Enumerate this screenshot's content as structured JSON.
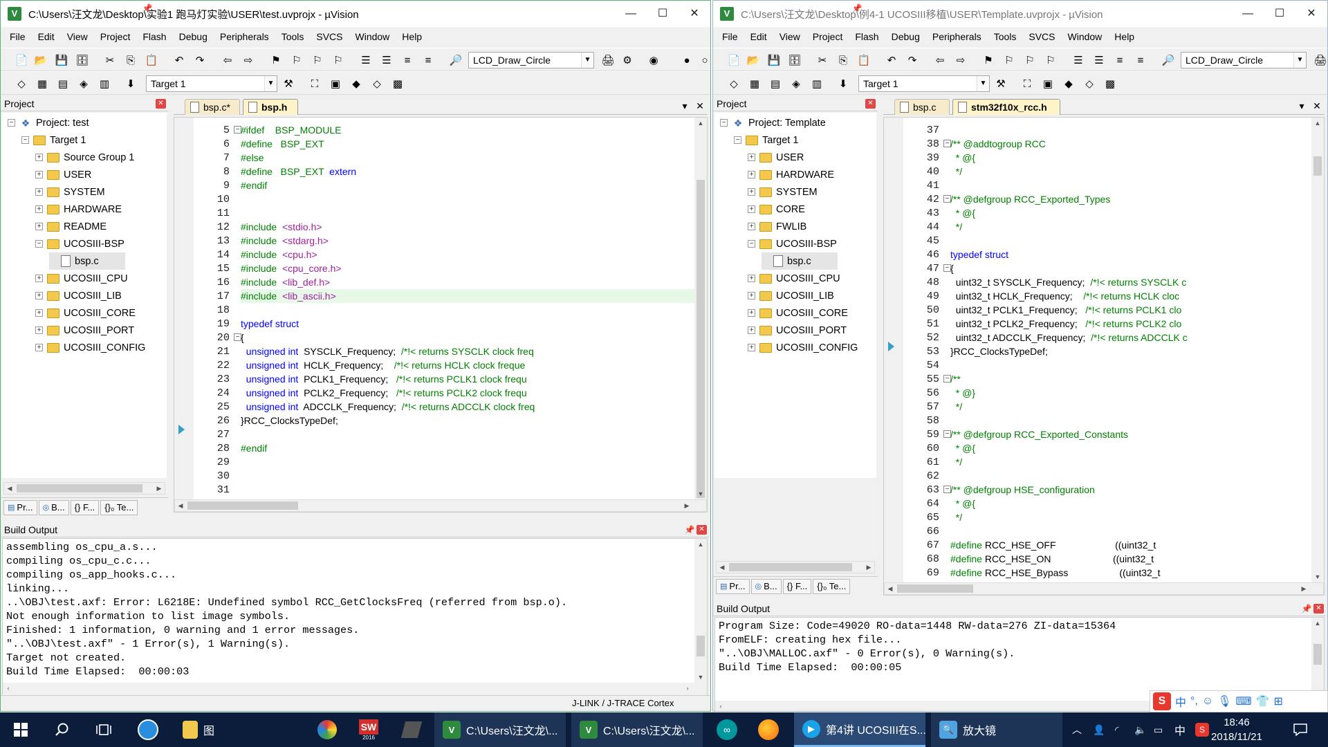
{
  "left": {
    "title": "C:\\Users\\汪文龙\\Desktop\\实验1 跑马灯实验\\USER\\test.uvprojx - µVision",
    "menu": [
      "File",
      "Edit",
      "View",
      "Project",
      "Flash",
      "Debug",
      "Peripherals",
      "Tools",
      "SVCS",
      "Window",
      "Help"
    ],
    "func_combo": "LCD_Draw_Circle",
    "target_combo": "Target 1",
    "project_panel_title": "Project",
    "tree": [
      {
        "label": "Project: test",
        "level": 0,
        "type": "project",
        "exp": "-"
      },
      {
        "label": "Target 1",
        "level": 1,
        "type": "folder",
        "exp": "-"
      },
      {
        "label": "Source Group 1",
        "level": 2,
        "type": "folder",
        "exp": "+"
      },
      {
        "label": "USER",
        "level": 2,
        "type": "folder",
        "exp": "+"
      },
      {
        "label": "SYSTEM",
        "level": 2,
        "type": "folder",
        "exp": "+"
      },
      {
        "label": "HARDWARE",
        "level": 2,
        "type": "folder",
        "exp": "+"
      },
      {
        "label": "README",
        "level": 2,
        "type": "folder",
        "exp": "+"
      },
      {
        "label": "UCOSIII-BSP",
        "level": 2,
        "type": "folder",
        "exp": "-"
      },
      {
        "label": "bsp.c",
        "level": 3,
        "type": "file",
        "exp": ""
      },
      {
        "label": "UCOSIII_CPU",
        "level": 2,
        "type": "folder",
        "exp": "+"
      },
      {
        "label": "UCOSIII_LIB",
        "level": 2,
        "type": "folder",
        "exp": "+"
      },
      {
        "label": "UCOSIII_CORE",
        "level": 2,
        "type": "folder",
        "exp": "+"
      },
      {
        "label": "UCOSIII_PORT",
        "level": 2,
        "type": "folder",
        "exp": "+"
      },
      {
        "label": "UCOSIII_CONFIG",
        "level": 2,
        "type": "folder",
        "exp": "+"
      }
    ],
    "bottom_tabs": [
      "Pr...",
      "B...",
      "{} F...",
      "{}₀ Te..."
    ],
    "editor_tabs": [
      {
        "label": "bsp.c*",
        "active": false
      },
      {
        "label": "bsp.h",
        "active": true
      }
    ],
    "code": [
      {
        "n": "5",
        "fold": "-",
        "t": [
          [
            "pp",
            "#ifdef    BSP_MODULE"
          ]
        ]
      },
      {
        "n": "6",
        "t": [
          [
            "pp",
            "#define   BSP_EXT"
          ]
        ]
      },
      {
        "n": "7",
        "t": [
          [
            "pp",
            "#else"
          ]
        ]
      },
      {
        "n": "8",
        "t": [
          [
            "pp",
            "#define   BSP_EXT  "
          ],
          [
            "kw",
            "extern"
          ]
        ]
      },
      {
        "n": "9",
        "t": [
          [
            "pp",
            "#endif"
          ]
        ]
      },
      {
        "n": "10",
        "t": []
      },
      {
        "n": "11",
        "t": []
      },
      {
        "n": "12",
        "t": [
          [
            "pp",
            "#include  "
          ],
          [
            "str",
            "<stdio.h>"
          ]
        ]
      },
      {
        "n": "13",
        "t": [
          [
            "pp",
            "#include  "
          ],
          [
            "str",
            "<stdarg.h>"
          ]
        ]
      },
      {
        "n": "14",
        "t": [
          [
            "pp",
            "#include  "
          ],
          [
            "str",
            "<cpu.h>"
          ]
        ]
      },
      {
        "n": "15",
        "t": [
          [
            "pp",
            "#include  "
          ],
          [
            "str",
            "<cpu_core.h>"
          ]
        ]
      },
      {
        "n": "16",
        "t": [
          [
            "pp",
            "#include  "
          ],
          [
            "str",
            "<lib_def.h>"
          ]
        ]
      },
      {
        "n": "17",
        "hl": true,
        "t": [
          [
            "pp",
            "#include  "
          ],
          [
            "str",
            "<lib_ascii.h>"
          ]
        ]
      },
      {
        "n": "18",
        "t": []
      },
      {
        "n": "19",
        "t": [
          [
            "kw",
            "typedef struct"
          ]
        ]
      },
      {
        "n": "20",
        "fold": "-",
        "t": [
          [
            "tx",
            "{"
          ]
        ]
      },
      {
        "n": "21",
        "t": [
          [
            "kw",
            "  unsigned int  "
          ],
          [
            "tx",
            "SYSCLK_Frequency;  "
          ],
          [
            "cm",
            "/*!< returns SYSCLK clock freq"
          ]
        ]
      },
      {
        "n": "22",
        "t": [
          [
            "kw",
            "  unsigned int  "
          ],
          [
            "tx",
            "HCLK_Frequency;    "
          ],
          [
            "cm",
            "/*!< returns HCLK clock freque"
          ]
        ]
      },
      {
        "n": "23",
        "t": [
          [
            "kw",
            "  unsigned int  "
          ],
          [
            "tx",
            "PCLK1_Frequency;   "
          ],
          [
            "cm",
            "/*!< returns PCLK1 clock frequ"
          ]
        ]
      },
      {
        "n": "24",
        "t": [
          [
            "kw",
            "  unsigned int  "
          ],
          [
            "tx",
            "PCLK2_Frequency;   "
          ],
          [
            "cm",
            "/*!< returns PCLK2 clock frequ"
          ]
        ]
      },
      {
        "n": "25",
        "t": [
          [
            "kw",
            "  unsigned int  "
          ],
          [
            "tx",
            "ADCCLK_Frequency;  "
          ],
          [
            "cm",
            "/*!< returns ADCCLK clock freq"
          ]
        ]
      },
      {
        "n": "26",
        "t": [
          [
            "tx",
            "}RCC_ClocksTypeDef;"
          ]
        ]
      },
      {
        "n": "27",
        "t": []
      },
      {
        "n": "28",
        "t": [
          [
            "pp",
            "#endif"
          ]
        ]
      },
      {
        "n": "29",
        "t": []
      },
      {
        "n": "30",
        "t": []
      },
      {
        "n": "31",
        "t": []
      }
    ],
    "build_title": "Build Output",
    "build": [
      "assembling os_cpu_a.s...",
      "compiling os_cpu_c.c...",
      "compiling os_app_hooks.c...",
      "linking...",
      "..\\OBJ\\test.axf: Error: L6218E: Undefined symbol RCC_GetClocksFreq (referred from bsp.o).",
      "Not enough information to list image symbols.",
      "Finished: 1 information, 0 warning and 1 error messages.",
      "\"..\\OBJ\\test.axf\" - 1 Error(s), 1 Warning(s).",
      "Target not created.",
      "Build Time Elapsed:  00:00:03"
    ],
    "status": "J-LINK / J-TRACE Cortex"
  },
  "right": {
    "title": "C:\\Users\\汪文龙\\Desktop\\例4-1 UCOSIII移植\\USER\\Template.uvprojx - µVision",
    "menu": [
      "File",
      "Edit",
      "View",
      "Project",
      "Flash",
      "Debug",
      "Peripherals",
      "Tools",
      "SVCS",
      "Window",
      "Help"
    ],
    "func_combo": "LCD_Draw_Circle",
    "target_combo": "Target 1",
    "project_panel_title": "Project",
    "tree": [
      {
        "label": "Project: Template",
        "level": 0,
        "type": "project",
        "exp": "-"
      },
      {
        "label": "Target 1",
        "level": 1,
        "type": "folder",
        "exp": "-"
      },
      {
        "label": "USER",
        "level": 2,
        "type": "folder",
        "exp": "+"
      },
      {
        "label": "HARDWARE",
        "level": 2,
        "type": "folder",
        "exp": "+"
      },
      {
        "label": "SYSTEM",
        "level": 2,
        "type": "folder",
        "exp": "+"
      },
      {
        "label": "CORE",
        "level": 2,
        "type": "folder",
        "exp": "+"
      },
      {
        "label": "FWLIB",
        "level": 2,
        "type": "folder",
        "exp": "+"
      },
      {
        "label": "UCOSIII-BSP",
        "level": 2,
        "type": "folder",
        "exp": "-"
      },
      {
        "label": "bsp.c",
        "level": 3,
        "type": "file",
        "exp": ""
      },
      {
        "label": "UCOSIII_CPU",
        "level": 2,
        "type": "folder",
        "exp": "+"
      },
      {
        "label": "UCOSIII_LIB",
        "level": 2,
        "type": "folder",
        "exp": "+"
      },
      {
        "label": "UCOSIII_CORE",
        "level": 2,
        "type": "folder",
        "exp": "+"
      },
      {
        "label": "UCOSIII_PORT",
        "level": 2,
        "type": "folder",
        "exp": "+"
      },
      {
        "label": "UCOSIII_CONFIG",
        "level": 2,
        "type": "folder",
        "exp": "+"
      }
    ],
    "bottom_tabs": [
      "Pr...",
      "B...",
      "{} F...",
      "{}₀ Te..."
    ],
    "editor_tabs": [
      {
        "label": "bsp.c",
        "active": false
      },
      {
        "label": "stm32f10x_rcc.h",
        "active": true
      }
    ],
    "code": [
      {
        "n": "37",
        "t": []
      },
      {
        "n": "38",
        "fold": "-",
        "t": [
          [
            "doc",
            "/** @addtogroup RCC"
          ]
        ]
      },
      {
        "n": "39",
        "t": [
          [
            "doc",
            "  * @{"
          ]
        ]
      },
      {
        "n": "40",
        "t": [
          [
            "doc",
            "  */"
          ]
        ]
      },
      {
        "n": "41",
        "t": []
      },
      {
        "n": "42",
        "fold": "-",
        "t": [
          [
            "doc",
            "/** @defgroup RCC_Exported_Types"
          ]
        ]
      },
      {
        "n": "43",
        "t": [
          [
            "doc",
            "  * @{"
          ]
        ]
      },
      {
        "n": "44",
        "t": [
          [
            "doc",
            "  */"
          ]
        ]
      },
      {
        "n": "45",
        "t": []
      },
      {
        "n": "46",
        "t": [
          [
            "kw",
            "typedef struct"
          ]
        ]
      },
      {
        "n": "47",
        "fold": "-",
        "t": [
          [
            "tx",
            "{"
          ]
        ]
      },
      {
        "n": "48",
        "t": [
          [
            "tx",
            "  uint32_t SYSCLK_Frequency;  "
          ],
          [
            "cm",
            "/*!< returns SYSCLK c"
          ]
        ]
      },
      {
        "n": "49",
        "t": [
          [
            "tx",
            "  uint32_t HCLK_Frequency;    "
          ],
          [
            "cm",
            "/*!< returns HCLK cloc"
          ]
        ]
      },
      {
        "n": "50",
        "t": [
          [
            "tx",
            "  uint32_t PCLK1_Frequency;   "
          ],
          [
            "cm",
            "/*!< returns PCLK1 clo"
          ]
        ]
      },
      {
        "n": "51",
        "t": [
          [
            "tx",
            "  uint32_t PCLK2_Frequency;   "
          ],
          [
            "cm",
            "/*!< returns PCLK2 clo"
          ]
        ]
      },
      {
        "n": "52",
        "t": [
          [
            "tx",
            "  uint32_t ADCCLK_Frequency;  "
          ],
          [
            "cm",
            "/*!< returns ADCCLK c"
          ]
        ]
      },
      {
        "n": "53",
        "t": [
          [
            "tx",
            "}RCC_ClocksTypeDef;"
          ]
        ]
      },
      {
        "n": "54",
        "t": []
      },
      {
        "n": "55",
        "fold": "-",
        "t": [
          [
            "doc",
            "/**"
          ]
        ]
      },
      {
        "n": "56",
        "t": [
          [
            "doc",
            "  * @}"
          ]
        ]
      },
      {
        "n": "57",
        "t": [
          [
            "doc",
            "  */"
          ]
        ]
      },
      {
        "n": "58",
        "t": []
      },
      {
        "n": "59",
        "fold": "-",
        "t": [
          [
            "doc",
            "/** @defgroup RCC_Exported_Constants"
          ]
        ]
      },
      {
        "n": "60",
        "t": [
          [
            "doc",
            "  * @{"
          ]
        ]
      },
      {
        "n": "61",
        "t": [
          [
            "doc",
            "  */"
          ]
        ]
      },
      {
        "n": "62",
        "t": []
      },
      {
        "n": "63",
        "fold": "-",
        "t": [
          [
            "doc",
            "/** @defgroup HSE_configuration"
          ]
        ]
      },
      {
        "n": "64",
        "t": [
          [
            "doc",
            "  * @{"
          ]
        ]
      },
      {
        "n": "65",
        "t": [
          [
            "doc",
            "  */"
          ]
        ]
      },
      {
        "n": "66",
        "t": []
      },
      {
        "n": "67",
        "t": [
          [
            "pp",
            "#define "
          ],
          [
            "tx",
            "RCC_HSE_OFF                      ((uint32_t"
          ]
        ]
      },
      {
        "n": "68",
        "t": [
          [
            "pp",
            "#define "
          ],
          [
            "tx",
            "RCC_HSE_ON                       ((uint32_t"
          ]
        ]
      },
      {
        "n": "69",
        "t": [
          [
            "pp",
            "#define "
          ],
          [
            "tx",
            "RCC_HSE_Bypass                   ((uint32_t"
          ]
        ]
      }
    ],
    "build_title": "Build Output",
    "build": [
      "Program Size: Code=49020 RO-data=1448 RW-data=276 ZI-data=15364",
      "FromELF: creating hex file...",
      "\"..\\OBJ\\MALLOC.axf\" - 0 Error(s), 0 Warning(s).",
      "Build Time Elapsed:  00:00:05"
    ]
  },
  "taskbar": {
    "apps": [
      {
        "label": "C:\\Users\\汪文龙\\...",
        "icon": "uvision-icon"
      },
      {
        "label": "C:\\Users\\汪文龙\\...",
        "icon": "uvision-icon"
      },
      {
        "label": "第4讲 UCOSIII在S...",
        "icon": "video-icon"
      },
      {
        "label": "放大镜",
        "icon": "magnifier-icon"
      }
    ],
    "folder_label": "图",
    "sw_label": "SW",
    "sw_year": "2016",
    "time": "18:46",
    "date": "2018/11/21",
    "tray_lang": "中"
  },
  "ime": {
    "mode": "中",
    "punct": "°,"
  }
}
